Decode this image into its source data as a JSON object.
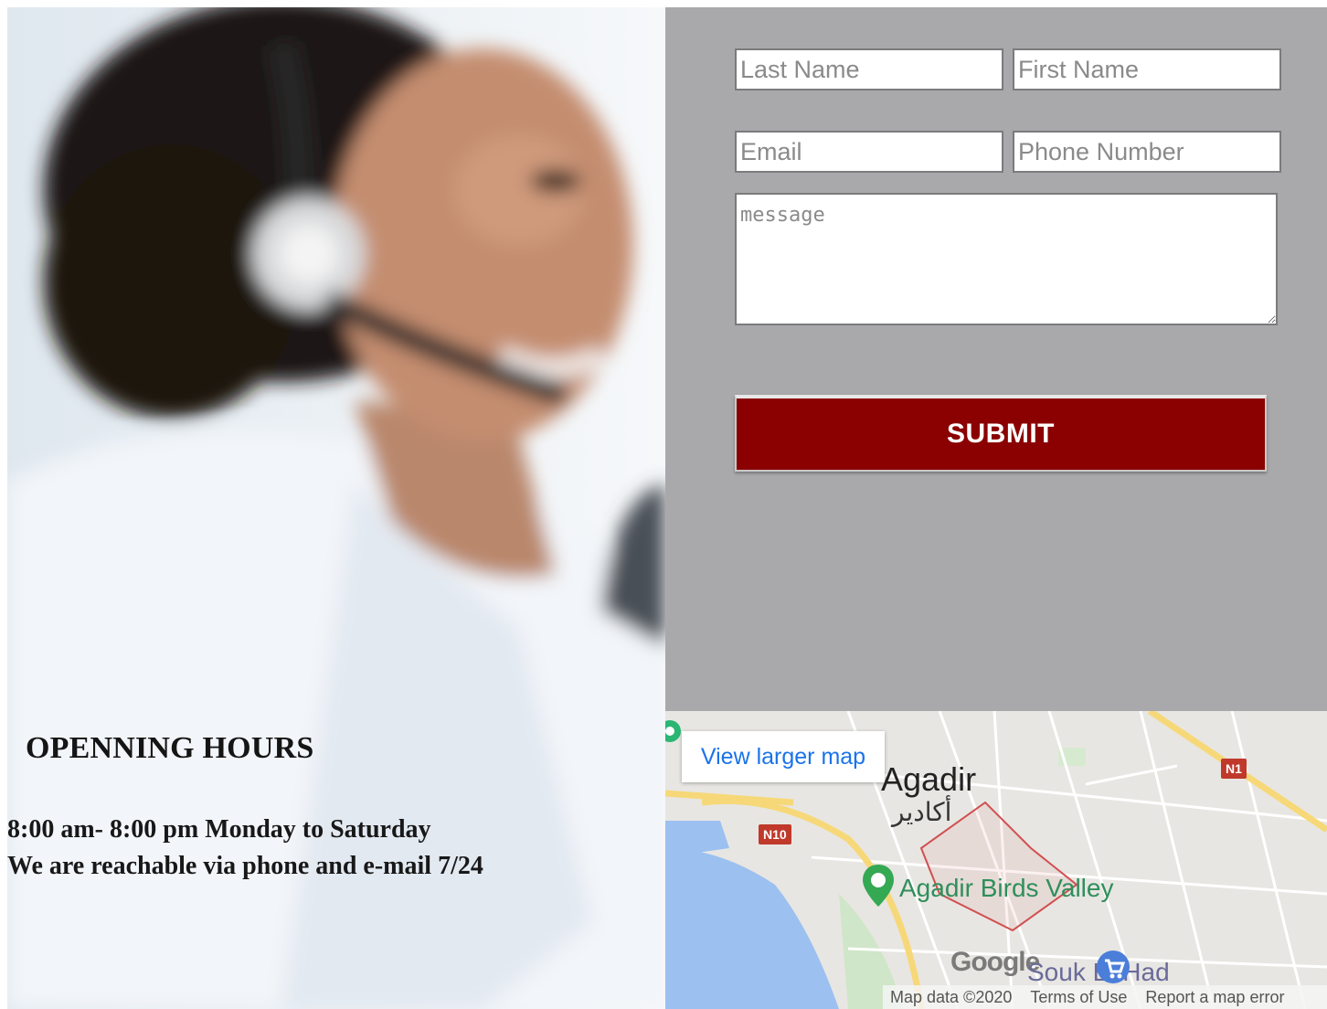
{
  "hours": {
    "title": "OPENNING HOURS",
    "line1": "8:00 am- 8:00 pm Monday to Saturday",
    "line2": "We are reachable via phone and e-mail 7/24"
  },
  "form": {
    "last_name_placeholder": "Last Name",
    "first_name_placeholder": "First Name",
    "email_placeholder": "Email",
    "phone_placeholder": "Phone Number",
    "message_placeholder": "message",
    "submit_label": "SUBMIT"
  },
  "map": {
    "view_larger_label": "View larger map",
    "city": "Agadir",
    "city_arabic": "أكادير",
    "poi": "Agadir Birds Valley",
    "poi2": "Souk El Had",
    "badge_n10": "N10",
    "badge_n1": "N1",
    "google_logo": "Google",
    "footer": {
      "map_data": "Map data ©2020",
      "terms": "Terms of Use",
      "report": "Report a map error"
    }
  },
  "colors": {
    "form_bg": "#a9a9ab",
    "submit_bg": "#8b0000",
    "map_link": "#1a73e8"
  }
}
